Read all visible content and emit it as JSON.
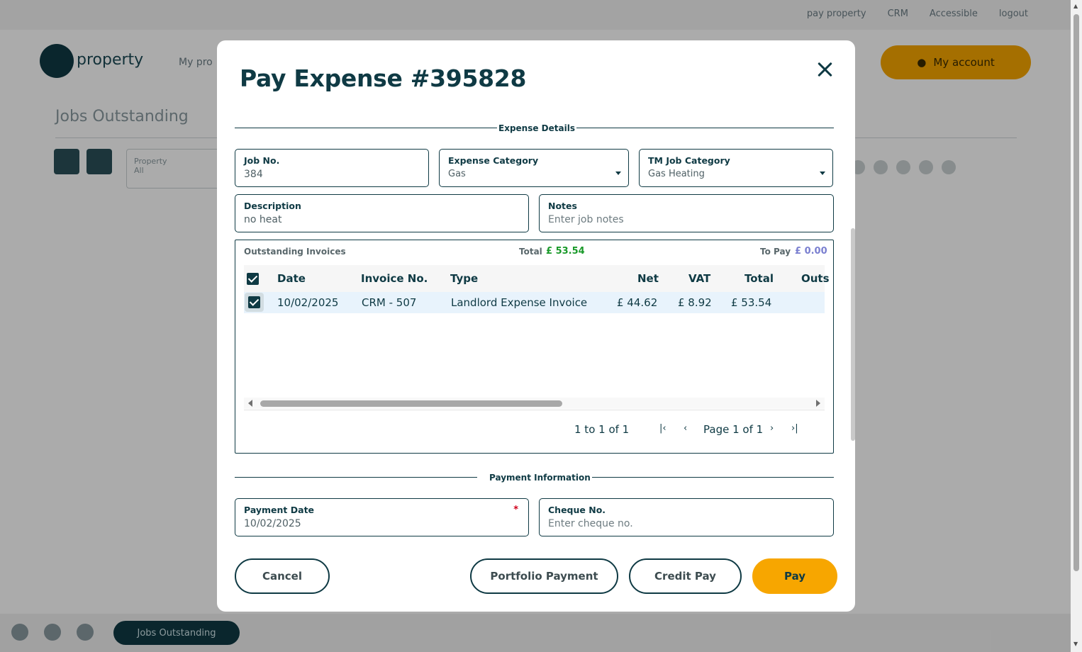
{
  "background": {
    "top_links": [
      "pay property",
      "CRM",
      "Accessible",
      "logout"
    ],
    "logo_text": "property",
    "nav_text": "My pro",
    "account_label": "My account",
    "page_title": "Jobs Outstanding",
    "filter_label": "Property",
    "filter_value": "All",
    "bottom_tab": "Jobs Outstanding"
  },
  "modal": {
    "title": "Pay Expense #395828",
    "close_icon": "close-icon",
    "expense_section_label": "Expense Details",
    "fields": {
      "job_no": {
        "label": "Job No.",
        "value": "384"
      },
      "expense_category": {
        "label": "Expense Category",
        "value": "Gas"
      },
      "tm_job_category": {
        "label": "TM Job Category",
        "value": "Gas Heating"
      },
      "description": {
        "label": "Description",
        "value": "no heat"
      },
      "notes": {
        "label": "Notes",
        "placeholder": "Enter job notes"
      }
    },
    "invoices": {
      "title": "Outstanding Invoices",
      "total_label": "Total",
      "total_value": "£ 53.54",
      "to_pay_label": "To Pay",
      "to_pay_value": "£ 0.00",
      "columns": [
        "Date",
        "Invoice No.",
        "Type",
        "Net",
        "VAT",
        "Total",
        "Outs"
      ],
      "rows": [
        {
          "date": "10/02/2025",
          "invoice_no": "CRM - 507",
          "type": "Landlord Expense Invoice",
          "net": "£ 44.62",
          "vat": "£ 8.92",
          "total": "£ 53.54",
          "checked": true
        }
      ],
      "pager": {
        "range": "1 to 1 of 1",
        "page": "Page 1 of 1"
      }
    },
    "payment_section_label": "Payment Information",
    "payment": {
      "payment_date": {
        "label": "Payment Date",
        "value": "10/02/2025",
        "required_mark": "*"
      },
      "cheque_no": {
        "label": "Cheque No.",
        "placeholder": "Enter cheque no."
      }
    },
    "buttons": {
      "cancel": "Cancel",
      "portfolio_payment": "Portfolio Payment",
      "credit_pay": "Credit Pay",
      "pay": "Pay"
    }
  },
  "colors": {
    "primary_dark": "#0f3a44",
    "accent_orange": "#f7a600",
    "total_green": "#1a9a2a",
    "to_pay_purple": "#7a7fd0",
    "row_highlight": "#e8f3fc",
    "required_red": "#d0021b"
  }
}
